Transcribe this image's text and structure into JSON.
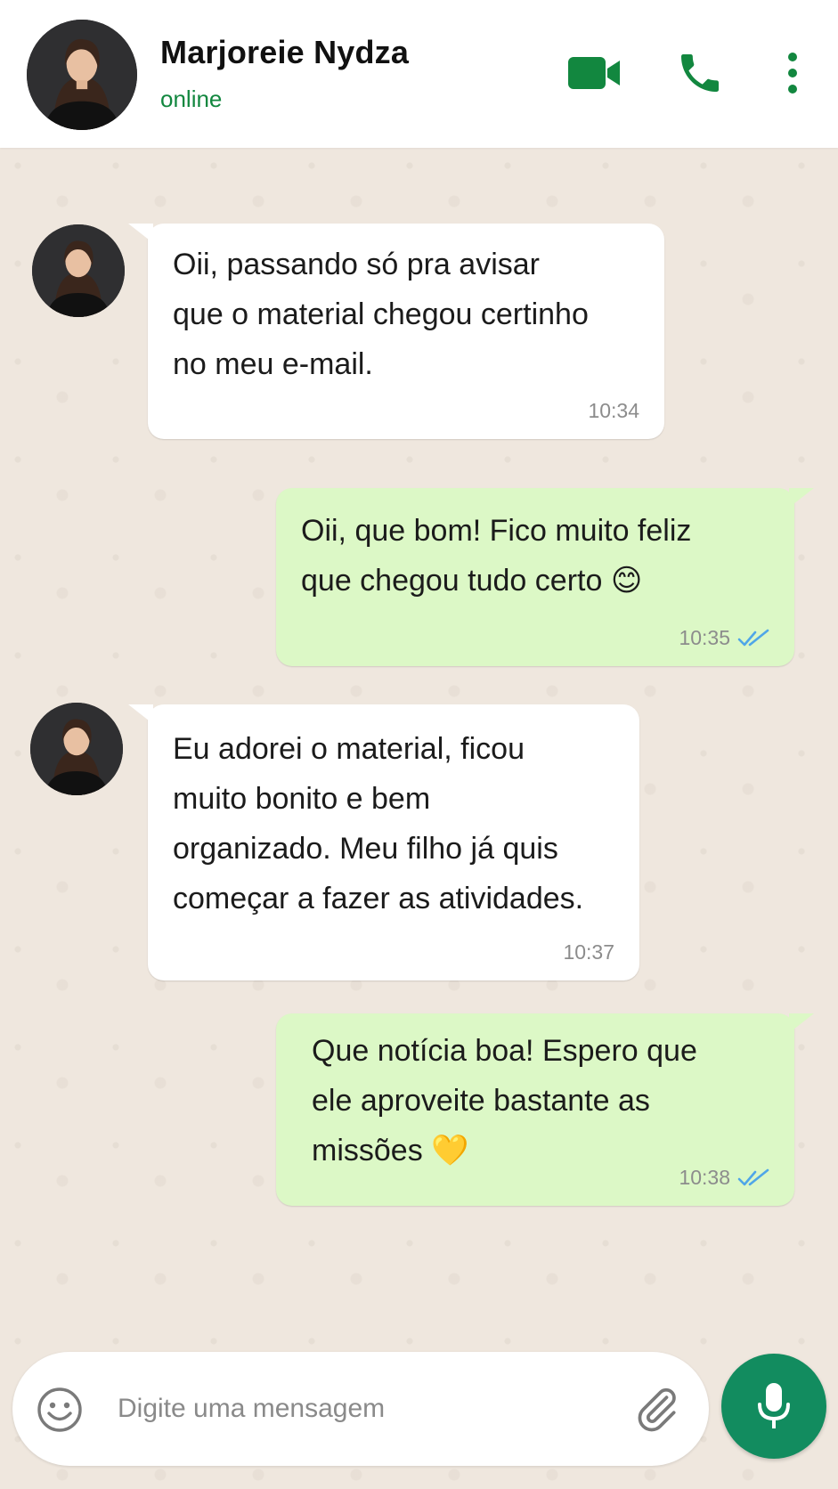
{
  "header": {
    "contact_name": "Marjoreie Nydza",
    "status": "online",
    "icons": [
      "video-call-icon",
      "voice-call-icon",
      "more-options-icon"
    ]
  },
  "messages": [
    {
      "direction": "incoming",
      "lines": [
        "Oii, passando só pra avisar",
        "que o material chegou certinho",
        "no meu e-mail."
      ],
      "time": "10:34"
    },
    {
      "direction": "outgoing",
      "lines": [
        "Oii, que bom! Fico muito feliz",
        "que chegou tudo certo 😊"
      ],
      "time": "10:35",
      "status": "read"
    },
    {
      "direction": "incoming",
      "lines": [
        "Eu adorei o material, ficou",
        "muito bonito e bem",
        "organizado. Meu filho já quis",
        "começar a fazer as atividades."
      ],
      "time": "10:37"
    },
    {
      "direction": "outgoing",
      "lines": [
        "Que notícia boa! Espero que",
        "ele aproveite bastante as",
        "missões 💛"
      ],
      "time": "10:38",
      "status": "read"
    }
  ],
  "input": {
    "placeholder": "Digite uma mensagem",
    "value": ""
  },
  "colors": {
    "brand_green": "#12873f",
    "outgoing_bubble": "#dcf8c6",
    "incoming_bubble": "#ffffff",
    "chat_background": "#efe7de",
    "read_tick": "#4fa6e8",
    "mic_button": "#128c5f"
  }
}
